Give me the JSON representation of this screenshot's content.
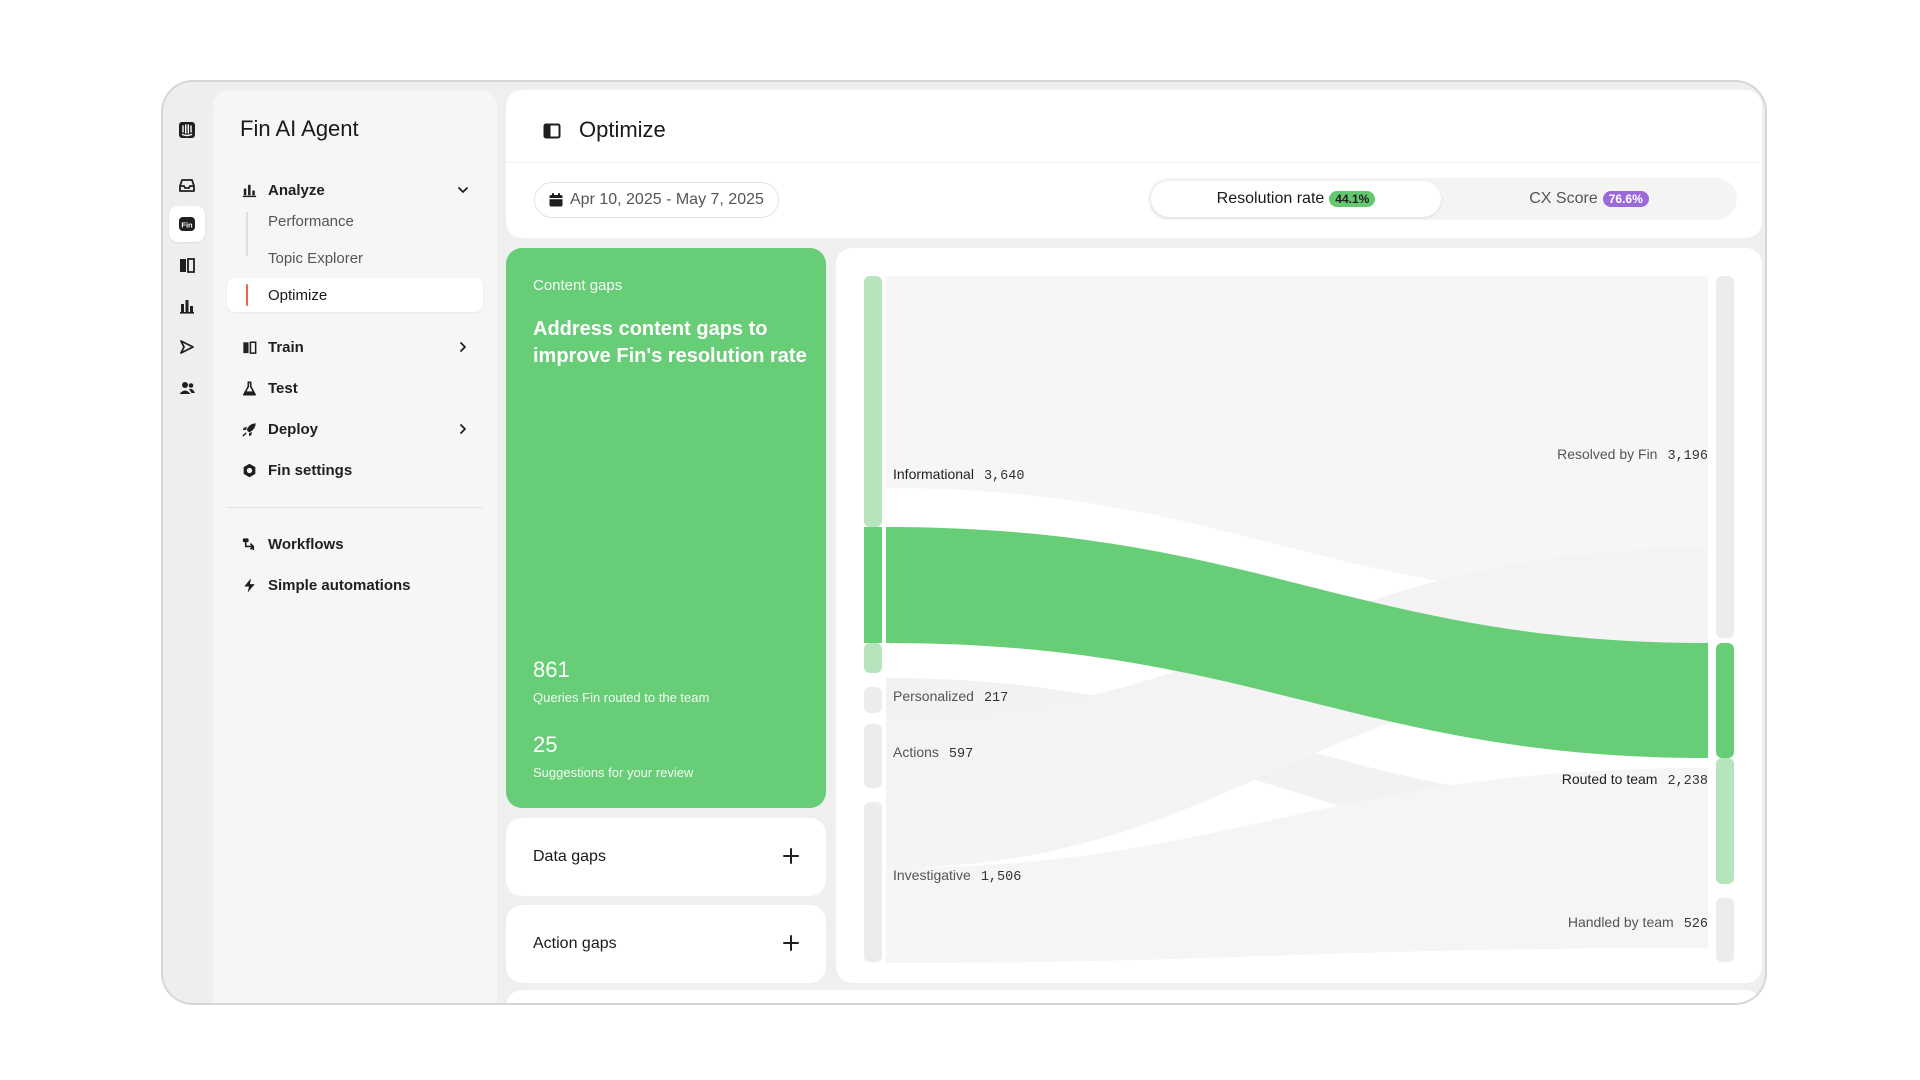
{
  "app": {
    "title": "Fin AI Agent"
  },
  "rail": {
    "icons": [
      "logo-icon",
      "inbox-icon",
      "fin-icon",
      "book-icon",
      "reports-icon",
      "outbound-icon",
      "contacts-icon"
    ]
  },
  "nav": {
    "analyze": {
      "label": "Analyze",
      "sub": [
        "Performance",
        "Topic Explorer",
        "Optimize"
      ]
    },
    "train": "Train",
    "test": "Test",
    "deploy": "Deploy",
    "settings": "Fin settings",
    "workflows": "Workflows",
    "automations": "Simple automations"
  },
  "header": {
    "title": "Optimize",
    "date_range": "Apr 10, 2025 - May 7, 2025",
    "tabs": [
      {
        "label": "Resolution rate",
        "badge": "44.1%",
        "badge_color": "#4fc35f"
      },
      {
        "label": "CX Score",
        "badge": "76.6%",
        "badge_color": "#9b6ad8"
      }
    ]
  },
  "content_gaps": {
    "kicker": "Content gaps",
    "headline": "Address content gaps to improve Fin's resolution rate",
    "stat1_value": "861",
    "stat1_label": "Queries Fin routed to the team",
    "stat2_value": "25",
    "stat2_label": "Suggestions for your review"
  },
  "gap_cards": {
    "data": "Data gaps",
    "action": "Action gaps"
  },
  "sankey": {
    "accent": "#67cd76",
    "sources": [
      {
        "label": "Informational",
        "value": "3,640"
      },
      {
        "label": "Personalized",
        "value": "217"
      },
      {
        "label": "Actions",
        "value": "597"
      },
      {
        "label": "Investigative",
        "value": "1,506"
      }
    ],
    "targets": [
      {
        "label": "Resolved by Fin",
        "value": "3,196"
      },
      {
        "label": "Routed to team",
        "value": "2,238"
      },
      {
        "label": "Handled by team",
        "value": "526"
      }
    ]
  }
}
